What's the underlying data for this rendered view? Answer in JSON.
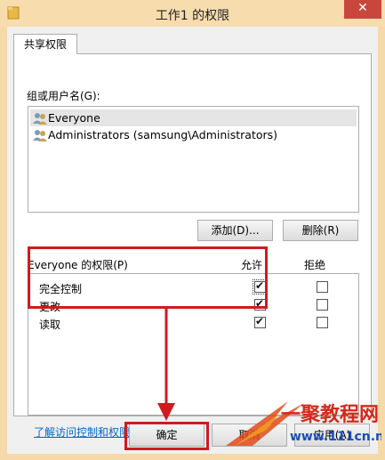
{
  "window": {
    "title": "工作1 的权限",
    "close_label": "✕"
  },
  "tabs": [
    {
      "label": "共享权限"
    }
  ],
  "group": {
    "label": "组或用户名(G):",
    "items": [
      {
        "label": "Everyone",
        "selected": true
      },
      {
        "label": "Administrators (samsung\\Administrators)",
        "selected": false
      }
    ]
  },
  "buttons": {
    "add": "添加(D)...",
    "remove": "删除(R)",
    "ok": "确定",
    "cancel": "取消",
    "apply": "应用(A)"
  },
  "permissions": {
    "header": "Everyone 的权限(P)",
    "allow_header": "允许",
    "deny_header": "拒绝",
    "rows": [
      {
        "name": "完全控制",
        "allow": true,
        "deny": false
      },
      {
        "name": "更改",
        "allow": true,
        "deny": false
      },
      {
        "name": "读取",
        "allow": true,
        "deny": false
      }
    ]
  },
  "link": "了解访问控制和权限",
  "watermark": {
    "text": "一聚教程网",
    "url": "www.111cn.net"
  },
  "colors": {
    "titlebar": "#f7dcae",
    "close": "#c9463d",
    "highlight_red": "#d11a1f",
    "link": "#0066cc"
  }
}
